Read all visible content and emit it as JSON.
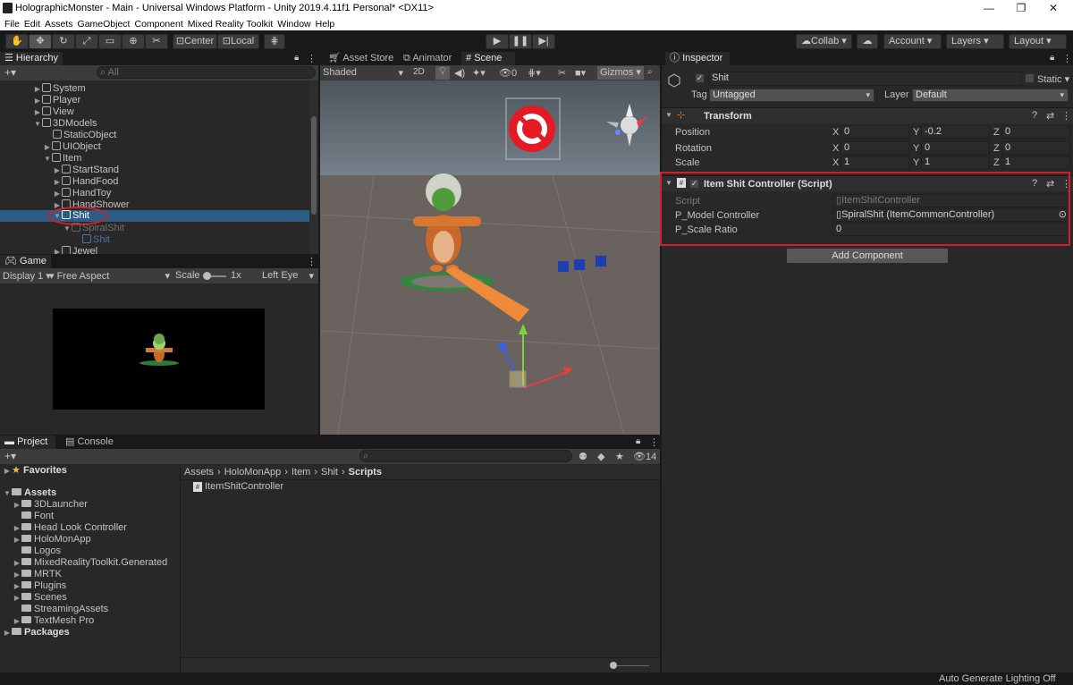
{
  "window": {
    "title": "HolographicMonster - Main - Universal Windows Platform - Unity 2019.4.11f1 Personal* <DX11>"
  },
  "menu": [
    "File",
    "Edit",
    "Assets",
    "GameObject",
    "Component",
    "Mixed Reality Toolkit",
    "Window",
    "Help"
  ],
  "toolbar": {
    "center_label": "Center",
    "local_label": "Local",
    "collab_label": "Collab",
    "account_label": "Account",
    "layers_label": "Layers",
    "layout_label": "Layout"
  },
  "hierarchy": {
    "tab": "Hierarchy",
    "search_placeholder": "All",
    "items": [
      {
        "label": "System"
      },
      {
        "label": "Player"
      },
      {
        "label": "View"
      },
      {
        "label": "3DModels"
      },
      {
        "label": "StaticObject"
      },
      {
        "label": "UIObject"
      },
      {
        "label": "Item"
      },
      {
        "label": "StartStand"
      },
      {
        "label": "HandFood"
      },
      {
        "label": "HandToy"
      },
      {
        "label": "HandShower"
      },
      {
        "label": "Shit"
      },
      {
        "label": "SpiralShit"
      },
      {
        "label": "Shit"
      },
      {
        "label": "Jewel"
      }
    ]
  },
  "game": {
    "tab": "Game",
    "display": "Display 1",
    "aspect": "Free Aspect",
    "scale_label": "Scale",
    "scale_value": "1x",
    "eye": "Left Eye"
  },
  "scene": {
    "tabs": [
      "Asset Store",
      "Animator",
      "Scene"
    ],
    "shading": "Shaded",
    "mode_2d": "2D",
    "gizmos": "Gizmos",
    "hidden_count": "0"
  },
  "inspector": {
    "tab": "Inspector",
    "object_name": "Shit",
    "static_label": "Static",
    "tag_label": "Tag",
    "tag_value": "Untagged",
    "layer_label": "Layer",
    "layer_value": "Default",
    "transform": {
      "title": "Transform",
      "position": {
        "label": "Position",
        "x": "0",
        "y": "-0.2",
        "z": "0"
      },
      "rotation": {
        "label": "Rotation",
        "x": "0",
        "y": "0",
        "z": "0"
      },
      "scale": {
        "label": "Scale",
        "x": "1",
        "y": "1",
        "z": "1"
      }
    },
    "script_component": {
      "title": "Item Shit Controller (Script)",
      "script_label": "Script",
      "script_value": "ItemShitController",
      "model_label": "P_Model Controller",
      "model_value": "SpiralShit (ItemCommonController)",
      "scale_label": "P_Scale Ratio",
      "scale_value": "0"
    },
    "add_component": "Add Component"
  },
  "project": {
    "tabs": [
      "Project",
      "Console"
    ],
    "hidden_count": "14",
    "favorites": "Favorites",
    "assets": "Assets",
    "folders": [
      "3DLauncher",
      "Font",
      "Head Look Controller",
      "HoloMonApp",
      "Logos",
      "MixedRealityToolkit.Generated",
      "MRTK",
      "Plugins",
      "Scenes",
      "StreamingAssets",
      "TextMesh Pro"
    ],
    "packages": "Packages",
    "breadcrumb": [
      "Assets",
      "HoloMonApp",
      "Item",
      "Shit",
      "Scripts"
    ],
    "file": "ItemShitController"
  },
  "status": {
    "text": "Auto Generate Lighting Off"
  },
  "colors": {
    "selection": "#2c5d87",
    "highlight_red": "#d11f2b",
    "accent_orange": "#ef8a3a"
  }
}
